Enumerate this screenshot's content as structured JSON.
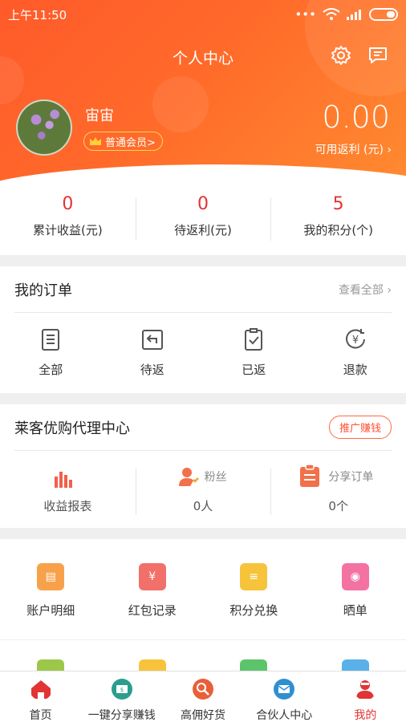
{
  "status_bar": {
    "time": "上午11:50",
    "dots": "•••"
  },
  "header": {
    "title": "个人中心"
  },
  "profile": {
    "name": "宙宙",
    "member_level": "普通会员>",
    "rebate_value": "0.00",
    "rebate_label": "可用返利 (元) ›"
  },
  "stats": [
    {
      "value": "0",
      "label": "累计收益(元)"
    },
    {
      "value": "0",
      "label": "待返利(元)"
    },
    {
      "value": "5",
      "label": "我的积分(个)"
    }
  ],
  "orders": {
    "title": "我的订单",
    "view_all": "查看全部 ›",
    "items": [
      {
        "label": "全部",
        "icon": "clipboard-list-icon"
      },
      {
        "label": "待返",
        "icon": "return-arrow-icon"
      },
      {
        "label": "已返",
        "icon": "clipboard-check-icon"
      },
      {
        "label": "退款",
        "icon": "yen-refund-icon"
      }
    ]
  },
  "agent": {
    "title": "莱客优购代理中心",
    "promo_button": "推广赚钱",
    "report_label": "收益报表",
    "fans": {
      "label": "粉丝",
      "value": "0人"
    },
    "shared_orders": {
      "label": "分享订单",
      "value": "0个"
    }
  },
  "tools": [
    {
      "label": "账户明细",
      "icon": "account-detail-icon",
      "color": "#f7a24b"
    },
    {
      "label": "红包记录",
      "icon": "red-envelope-icon",
      "color": "#f2706a"
    },
    {
      "label": "积分兑换",
      "icon": "coins-icon",
      "color": "#f6c33a"
    },
    {
      "label": "晒单",
      "icon": "camera-icon",
      "color": "#f472a2"
    }
  ],
  "tabbar": [
    {
      "label": "首页",
      "icon": "home-icon",
      "active": false
    },
    {
      "label": "一键分享赚钱",
      "icon": "share-money-icon",
      "active": false
    },
    {
      "label": "高佣好货",
      "icon": "search-goods-icon",
      "active": false
    },
    {
      "label": "合伙人中心",
      "icon": "partner-icon",
      "active": false
    },
    {
      "label": "我的",
      "icon": "profile-icon",
      "active": true
    }
  ],
  "colors": {
    "accent": "#ff6a2a",
    "highlight": "#e23434"
  }
}
